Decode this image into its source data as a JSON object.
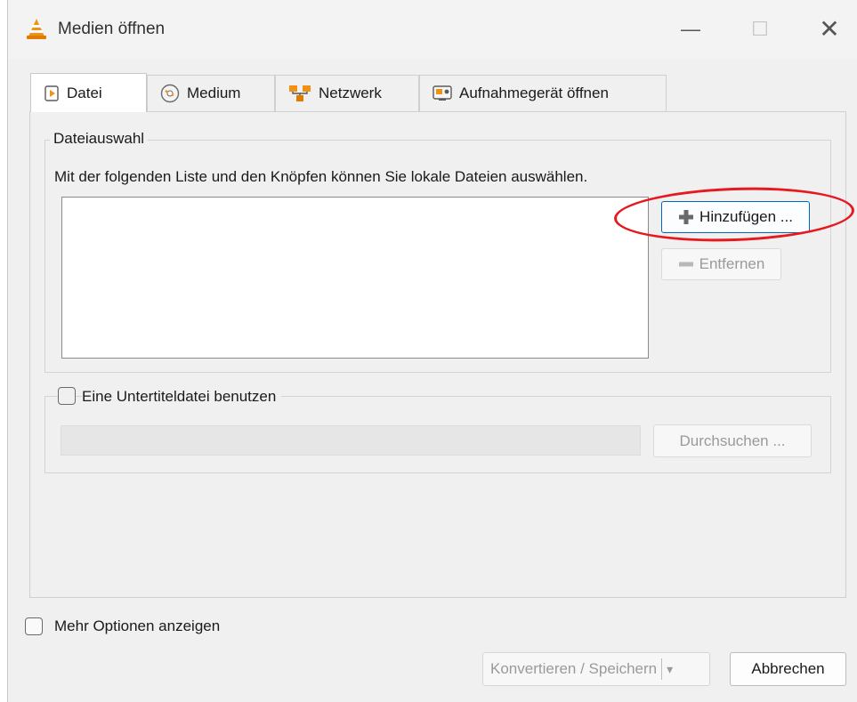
{
  "window": {
    "title": "Medien öffnen",
    "controls": {
      "minimize": "—",
      "maximize": "☐",
      "close": "✕"
    }
  },
  "tabs": [
    {
      "label": "Datei",
      "icon": "file-play-icon",
      "active": true
    },
    {
      "label": "Medium",
      "icon": "disc-icon",
      "active": false
    },
    {
      "label": "Netzwerk",
      "icon": "network-icon",
      "active": false
    },
    {
      "label": "Aufnahmegerät öffnen",
      "icon": "capture-device-icon",
      "active": false
    }
  ],
  "file_selection": {
    "legend": "Dateiauswahl",
    "description": "Mit der folgenden Liste und den Knöpfen können Sie lokale Dateien auswählen.",
    "add_button": "Hinzufügen ...",
    "remove_button": "Entfernen"
  },
  "subtitle": {
    "checkbox_label": "Eine Untertiteldatei benutzen",
    "checked": false,
    "browse_button": "Durchsuchen ..."
  },
  "more_options": {
    "label": "Mehr Optionen anzeigen",
    "checked": false
  },
  "footer": {
    "convert_save": "Konvertieren / Speichern",
    "dropdown_arrow": "▾",
    "cancel": "Abbrechen"
  },
  "colors": {
    "annotation": "#e8181f",
    "accent": "#0067c0"
  }
}
